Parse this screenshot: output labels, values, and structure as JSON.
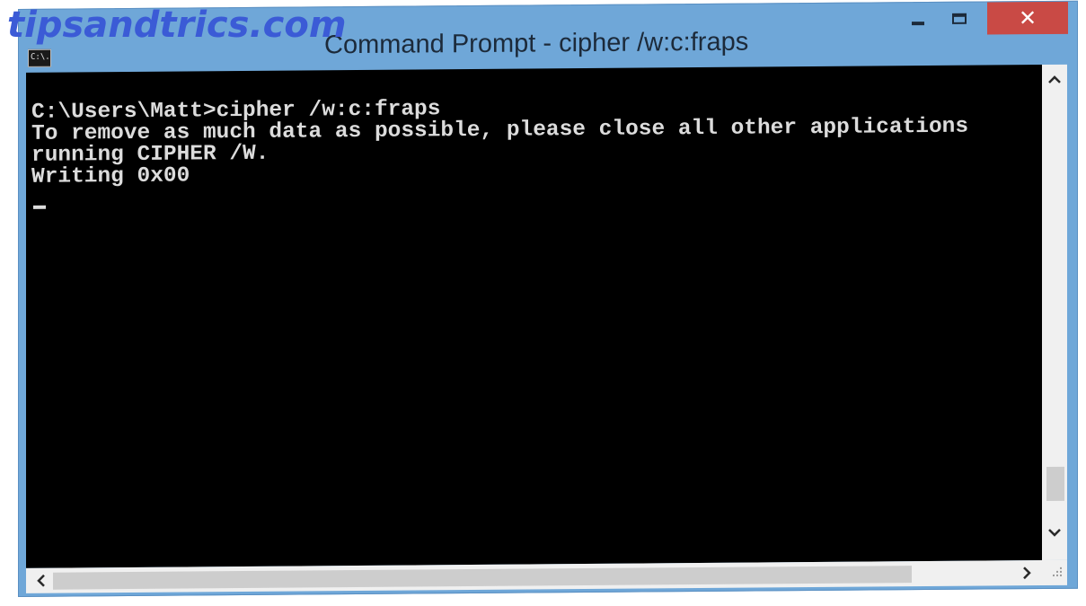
{
  "watermark": {
    "text": "tipsandtrics.com"
  },
  "window": {
    "title": "Command Prompt - cipher  /w:c:fraps",
    "icon": "cmd-app-icon",
    "icon_glyph": "C:\\."
  },
  "controls": {
    "minimize_icon": "minimize-icon",
    "maximize_icon": "maximize-icon",
    "close_glyph": "✕"
  },
  "console": {
    "lines": [
      "C:\\Users\\Matt>cipher /w:c:fraps",
      "To remove as much data as possible, please close all other applications",
      "running CIPHER /W.",
      "Writing 0x00"
    ]
  },
  "scrollbars": {
    "up_glyph": "^",
    "down_glyph": "v",
    "left_glyph": "<",
    "right_glyph": ">"
  },
  "colors": {
    "frame": "#6fa7d8",
    "console_bg": "#000000",
    "console_fg": "#dcdcdc",
    "close_button": "#c94a45",
    "watermark": "#3b5bd6"
  }
}
